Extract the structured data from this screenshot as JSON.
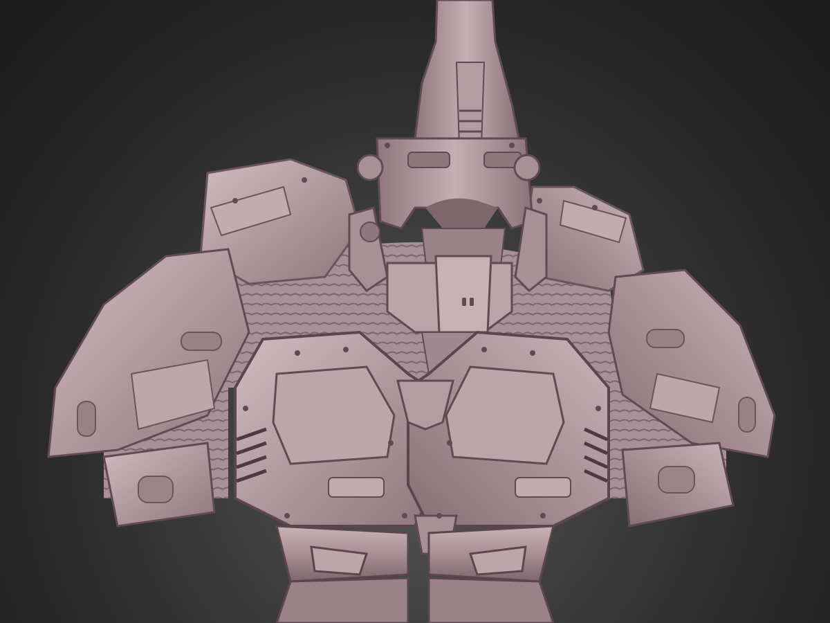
{
  "scene": {
    "subject": "sculpted-armored-bust",
    "material_color": "#b39aa0",
    "material_highlight": "#d8c3c8",
    "material_shadow": "#5e4a50",
    "background_top": "#1a1a1a",
    "background_bottom": "#4f4f4f"
  }
}
